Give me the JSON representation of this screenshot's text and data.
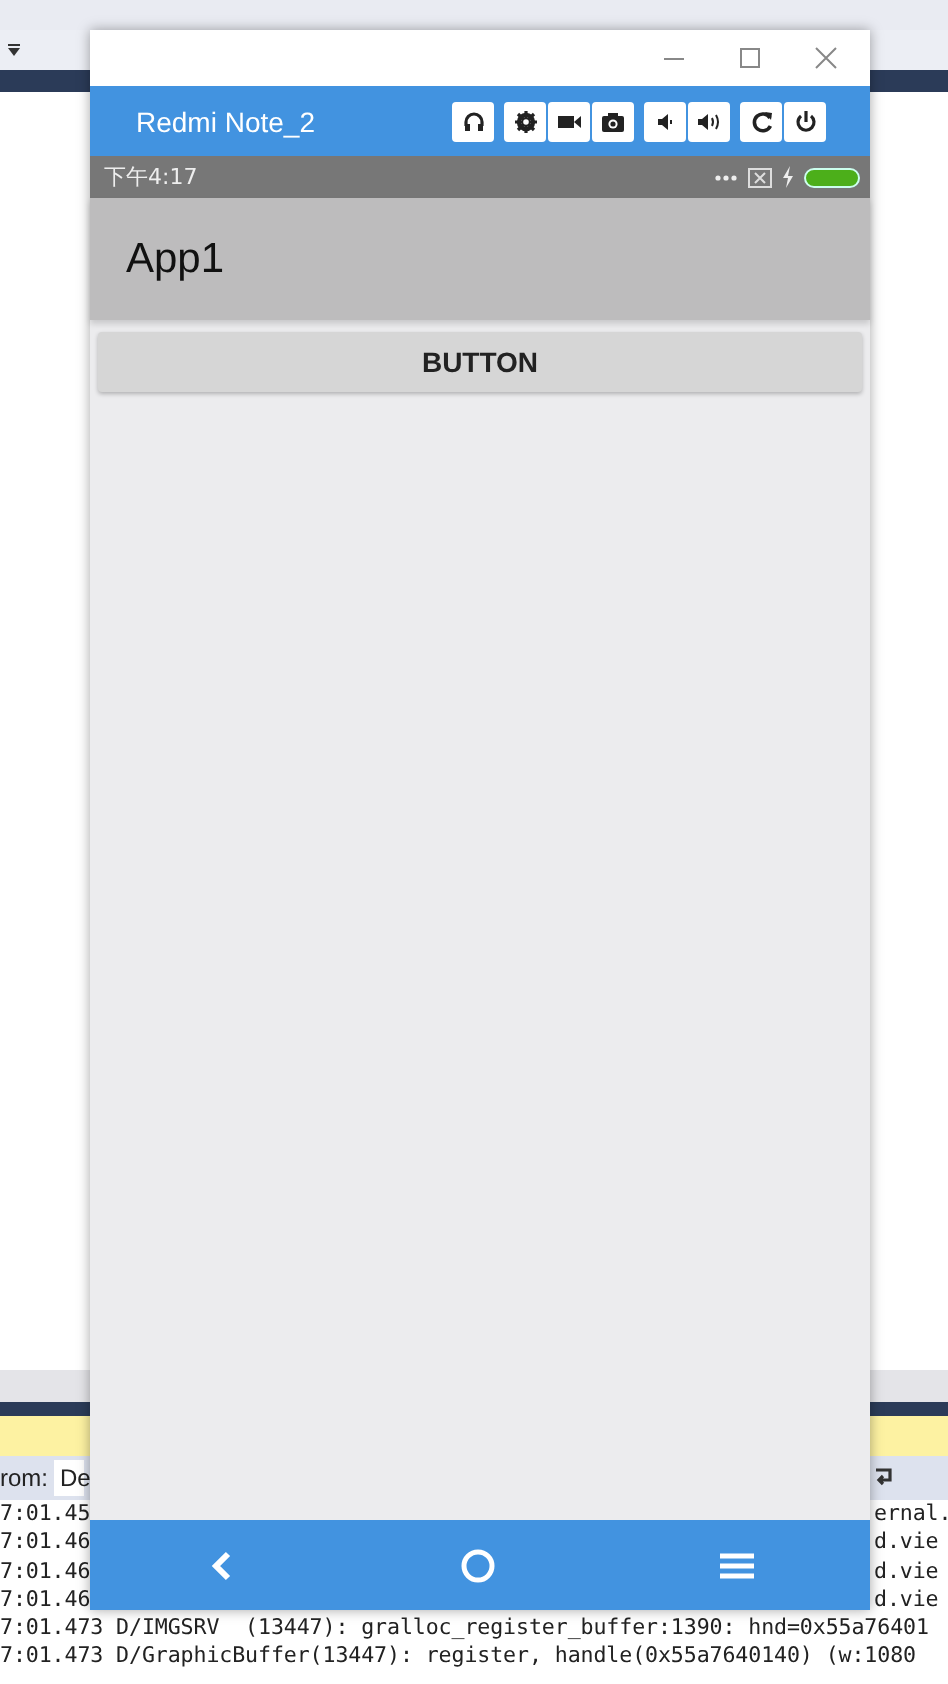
{
  "ide": {
    "from_label": "rom:",
    "from_value": "De",
    "log_lines": [
      {
        "left": "7:01.45",
        "right": "ernal."
      },
      {
        "left": "7:01.46",
        "right": "d.vie"
      },
      {
        "left": "7:01.46",
        "right": "d.vie"
      },
      {
        "left": "7:01.46",
        "right": "d.vie"
      },
      {
        "left": "7:01.473 D/IMGSRV  (13447): gralloc_register_buffer:1390: hnd=0x55a76401"
      },
      {
        "left": "7:01.473 D/GraphicBuffer(13447): register, handle(0x55a7640140) (w:1080"
      }
    ]
  },
  "emulator": {
    "device": "Redmi Note_2",
    "tool_groups": [
      {
        "buttons": [
          {
            "kind": "headset"
          }
        ]
      },
      {
        "buttons": [
          {
            "kind": "gear"
          },
          {
            "kind": "video"
          },
          {
            "kind": "camera"
          }
        ]
      },
      {
        "buttons": [
          {
            "kind": "volume-down"
          },
          {
            "kind": "volume-up"
          }
        ]
      },
      {
        "buttons": [
          {
            "kind": "rotate"
          },
          {
            "kind": "power"
          }
        ]
      }
    ],
    "status_time": "下午4:17",
    "app_title": "App1",
    "button_label": "BUTTON",
    "nav": [
      {
        "kind": "back"
      },
      {
        "kind": "home"
      },
      {
        "kind": "menu"
      }
    ]
  }
}
